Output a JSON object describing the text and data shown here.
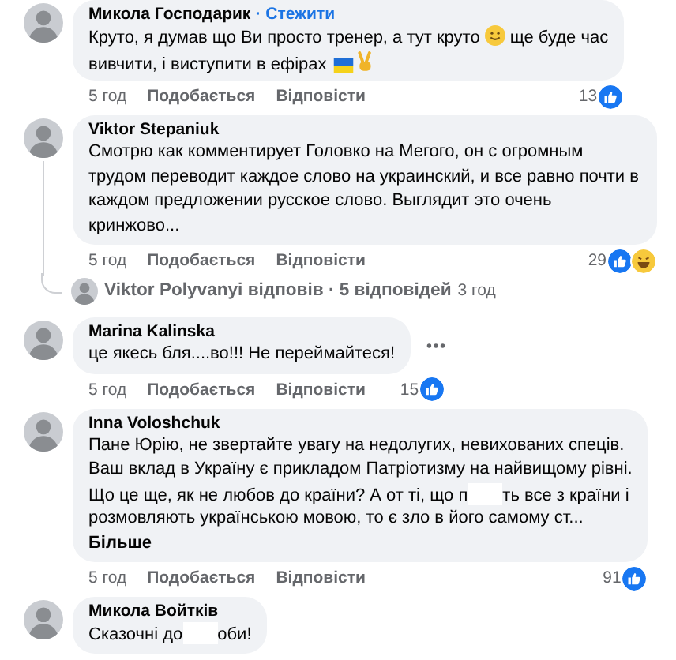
{
  "thread": [
    {
      "kind": "comment",
      "author": "Микола Господарик",
      "follow": "· Стежити",
      "menu_visible": false,
      "thread_line": false,
      "body": [
        [
          {
            "kind": "text",
            "text": "Круто, я думав що Ви просто тренер, а тут круто"
          },
          {
            "kind": "smiley"
          },
          {
            "kind": "text",
            "text": "ще буде час"
          }
        ],
        [
          {
            "kind": "text",
            "text": "вивчити, і виступити в ефірах"
          },
          {
            "kind": "flag"
          },
          {
            "kind": "victory"
          }
        ]
      ],
      "time": "5 год",
      "like": "Подобається",
      "reply": "Відповісти",
      "reaction_count": "13",
      "reactions": [
        {
          "kind": "like"
        }
      ]
    },
    {
      "kind": "comment",
      "author": "Viktor Stepaniuk",
      "menu_visible": false,
      "thread_line": true,
      "body": [
        [
          {
            "kind": "text",
            "text": "Смотрю как комментирует Головко на Мегого, он с огромным трудом переводит каждое слово на украинский, и все равно почти в каждом предложении русское слово. Выглядит это очень кринжово..."
          }
        ]
      ],
      "time": "5 год",
      "like": "Подобається",
      "reply": "Відповісти",
      "reaction_count": "29",
      "reactions": [
        {
          "kind": "like"
        },
        {
          "kind": "haha"
        }
      ]
    },
    {
      "kind": "replies",
      "text": "Viktor Polyvanyi відповів · 5 відповідей",
      "time": "3 год"
    },
    {
      "kind": "comment",
      "author": "Marina Kalinska",
      "menu_visible": true,
      "thread_line": false,
      "body": [
        [
          {
            "kind": "text",
            "text": "це якесь бля....во!!! Не переймайтеся!"
          }
        ]
      ],
      "time": "5 год",
      "like": "Подобається",
      "reply": "Відповісти",
      "reaction_count": "15",
      "reactions": [
        {
          "kind": "like"
        }
      ]
    },
    {
      "kind": "comment",
      "author": "Inna Voloshchuk",
      "menu_visible": false,
      "thread_line": false,
      "body": [
        [
          {
            "kind": "text",
            "text": "Пане Юрію, не звертайте увагу на недолугих, невихованих спеців."
          }
        ],
        [
          {
            "kind": "text",
            "text": "Ваш вклад в Україну є прикладом Патріотизму на найвищому рівні."
          }
        ],
        [
          {
            "kind": "text",
            "text": "Що це ще, як не любов до країни? А от ті, що п"
          },
          {
            "kind": "blank"
          },
          {
            "kind": "text",
            "text": "ть все з країни і"
          }
        ],
        [
          {
            "kind": "text",
            "text": "розмовляють українською мовою, то є зло в його самому ст..."
          }
        ]
      ],
      "more": "Більше",
      "time": "5 год",
      "like": "Подобається",
      "reply": "Відповісти",
      "reaction_count": "91",
      "reactions": [
        {
          "kind": "like"
        }
      ]
    },
    {
      "kind": "comment",
      "author": "Микола Войтків",
      "menu_visible": false,
      "thread_line": false,
      "body": [
        [
          {
            "kind": "text",
            "text": "Сказочні до"
          },
          {
            "kind": "blank"
          },
          {
            "kind": "text",
            "text": "оби!"
          }
        ]
      ]
    }
  ]
}
